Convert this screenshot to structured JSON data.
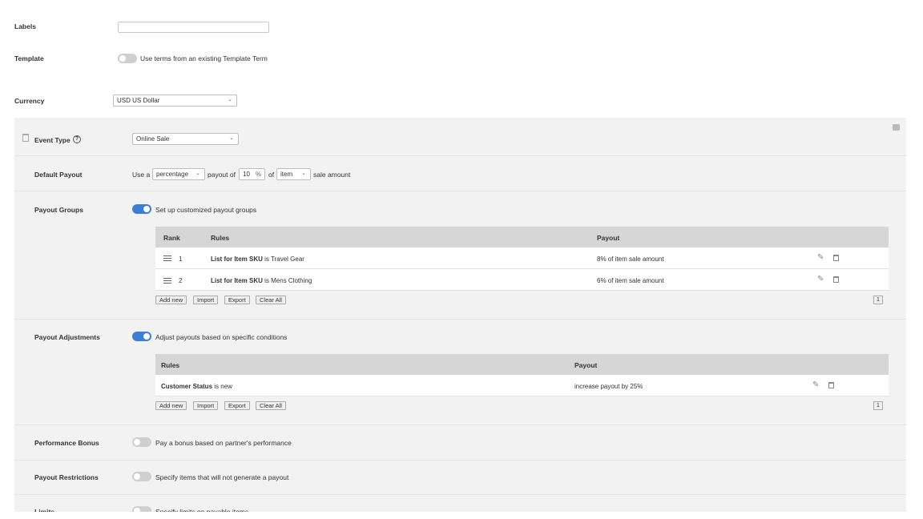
{
  "labels": {
    "label": "Labels",
    "value": ""
  },
  "template": {
    "label": "Template",
    "toggle_text": "Use terms from an existing Template Term",
    "enabled": false
  },
  "currency": {
    "label": "Currency",
    "value": "USD US Dollar"
  },
  "event_type": {
    "label": "Event Type",
    "help_icon": "question-circle-icon",
    "value": "Online Sale"
  },
  "default_payout": {
    "label": "Default Payout",
    "prefix": "Use a",
    "type_value": "percentage",
    "middle": "payout of",
    "amount": "10",
    "unit": "%",
    "of_text": "of",
    "basis_value": "item",
    "suffix": "sale amount"
  },
  "payout_groups": {
    "label": "Payout Groups",
    "toggle_text": "Set up customized payout groups",
    "enabled": true,
    "columns": [
      "Rank",
      "Rules",
      "Payout"
    ],
    "rows": [
      {
        "rank": "1",
        "rule_key": "List for Item SKU",
        "rule_rest": "is Travel Gear",
        "payout": "8% of item sale amount"
      },
      {
        "rank": "2",
        "rule_key": "List for Item SKU",
        "rule_rest": "is Mens Clothing",
        "payout": "6% of item sale amount"
      }
    ],
    "buttons": [
      "Add new",
      "Import",
      "Export",
      "Clear All"
    ],
    "page": "1"
  },
  "payout_adjustments": {
    "label": "Payout Adjustments",
    "toggle_text": "Adjust payouts based on specific conditions",
    "enabled": true,
    "columns": [
      "Rules",
      "Payout"
    ],
    "rows": [
      {
        "rule_key": "Customer Status",
        "rule_rest": "is new",
        "payout": "increase payout by 25%"
      }
    ],
    "buttons": [
      "Add new",
      "Import",
      "Export",
      "Clear All"
    ],
    "page": "1"
  },
  "performance_bonus": {
    "label": "Performance Bonus",
    "toggle_text": "Pay a bonus based on partner's performance",
    "enabled": false
  },
  "payout_restrictions": {
    "label": "Payout Restrictions",
    "toggle_text": "Specify items that will not generate a payout",
    "enabled": false
  },
  "limits": {
    "label": "Limits",
    "toggle_text": "Specify limits on payable items",
    "enabled": false
  },
  "colors": {
    "panel_bg": "#f2f2f2",
    "toggle_on": "#3b7fd4",
    "table_header": "#d6d6d6"
  }
}
